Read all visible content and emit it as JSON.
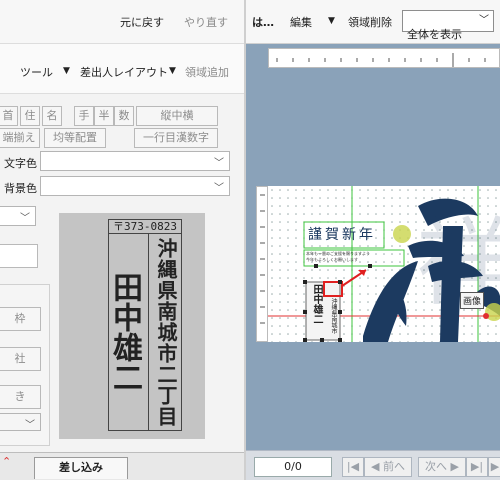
{
  "left_panel": {
    "toolbar_top": {
      "undo": "元に戻す",
      "redo": "やり直す"
    },
    "toolbar_second": {
      "tools": "ツール",
      "sender_layout": "差出人レイアウト",
      "add_area": "領域追加"
    },
    "char_buttons": [
      "首",
      "住",
      "名",
      "手",
      "半",
      "数"
    ],
    "vertical_horizontal": "縦中横",
    "align_buttons": {
      "justify": "端揃え",
      "even": "均等配置",
      "kanji_numeral": "一行目漢数字"
    },
    "text_color_label": "文字色",
    "bg_color_label": "背景色",
    "side_button_frame": "枠",
    "side_button_company": "社",
    "side_button_direction": "き",
    "preview": {
      "zip": "〒373‑0823",
      "name": "田中雄二",
      "address": "沖縄県南城市二丁目"
    },
    "tab_merge": "差し込み",
    "colors": {
      "panel": "#f3f3f3",
      "preview_bg": "#c4c4c4"
    }
  },
  "right_panel": {
    "toolbar": {
      "file_abbr": "は…",
      "edit": "編集",
      "delete_area": "領域削除",
      "zoom_select": "全体を表示"
    },
    "canvas": {
      "greeting": "謹賀新年",
      "subtext_line1": "本年も一層のご支援を賜りますよう",
      "subtext_line2": "今年もよろしくお願いします",
      "image_label": "画像",
      "calligraphy": "祥",
      "selected_card_name": "田中雄二",
      "selected_card_addr": "沖縄県南城市"
    },
    "bottom_bar": {
      "page": "0/0",
      "prev": "前へ",
      "next": "次へ"
    },
    "colors": {
      "background": "#8aa2b9",
      "guide_green": "#3ec43e",
      "guide_red": "#e03030",
      "ink": "#1c3a60"
    }
  }
}
